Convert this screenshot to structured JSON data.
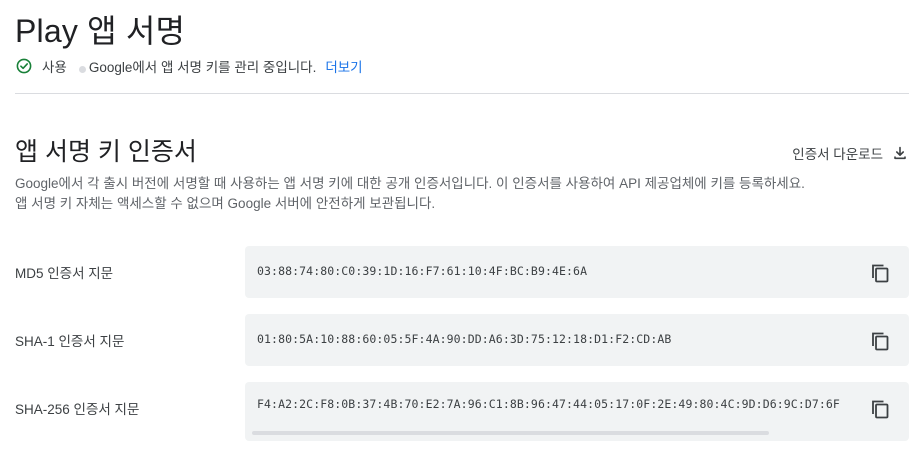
{
  "header": {
    "title": "Play 앱 서명",
    "status_label": "사용",
    "status_text": "Google에서 앱 서명 키를 관리 중입니다.",
    "learn_more": "더보기"
  },
  "certificate_section": {
    "title": "앱 서명 키 인증서",
    "download_label": "인증서 다운로드",
    "description_line1": "Google에서 각 출시 버전에 서명할 때 사용하는 앱 서명 키에 대한 공개 인증서입니다. 이 인증서를 사용하여 API 제공업체에 키를 등록하세요.",
    "description_line2": "앱 서명 키 자체는 액세스할 수 없으며 Google 서버에 안전하게 보관됩니다.",
    "fingerprints": [
      {
        "label": "MD5 인증서 지문",
        "value": "03:88:74:80:C0:39:1D:16:F7:61:10:4F:BC:B9:4E:6A"
      },
      {
        "label": "SHA-1 인증서 지문",
        "value": "01:80:5A:10:88:60:05:5F:4A:90:DD:A6:3D:75:12:18:D1:F2:CD:AB"
      },
      {
        "label": "SHA-256 인증서 지문",
        "value": "F4:A2:2C:F8:0B:37:4B:70:E2:7A:96:C1:8B:96:47:44:05:17:0F:2E:49:80:4C:9D:D6:9C:D7:6F"
      }
    ]
  },
  "icons": {
    "status": "check-circle-icon",
    "download": "download-icon",
    "copy": "copy-icon"
  },
  "colors": {
    "link": "#1a73e8",
    "success": "#188038",
    "box_background": "#f1f3f4"
  }
}
